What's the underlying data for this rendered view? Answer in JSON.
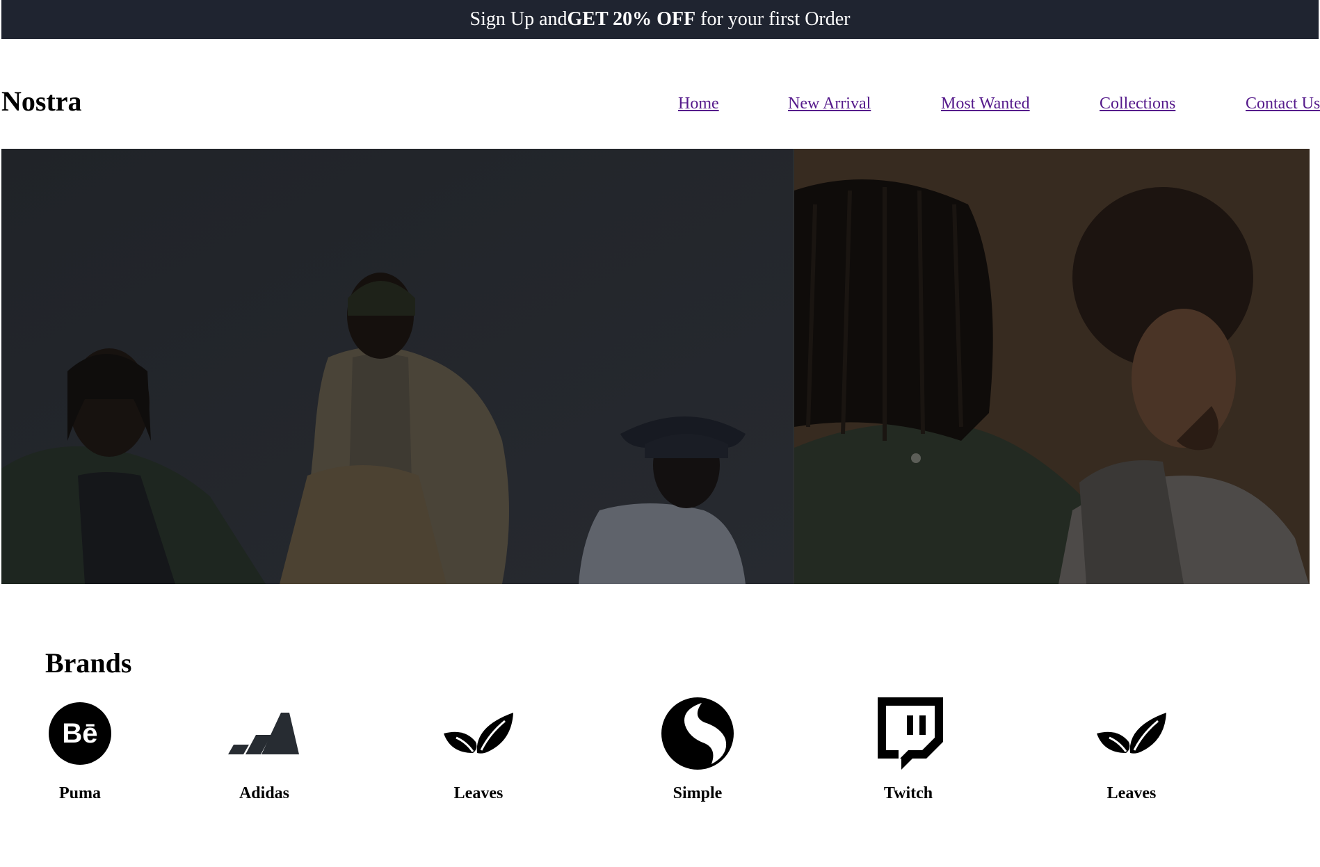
{
  "promo": {
    "prefix": "Sign Up and",
    "highlight": "GET 20% OFF",
    "suffix": " for your first Order"
  },
  "header": {
    "logo": "Nostra",
    "nav": [
      {
        "label": "Home"
      },
      {
        "label": "New Arrival"
      },
      {
        "label": "Most Wanted"
      },
      {
        "label": "Collections"
      },
      {
        "label": "Contact Us"
      }
    ]
  },
  "hero": {
    "left_image": "group-of-three-men-photo",
    "right_image": "two-men-portrait-photo"
  },
  "brands": {
    "title": "Brands",
    "items": [
      {
        "label": "Puma",
        "icon": "behance-icon"
      },
      {
        "label": "Adidas",
        "icon": "adidas-icon"
      },
      {
        "label": "Leaves",
        "icon": "leaves-icon"
      },
      {
        "label": "Simple",
        "icon": "simple-icon"
      },
      {
        "label": "Twitch",
        "icon": "twitch-icon"
      },
      {
        "label": "Leaves",
        "icon": "leaves-icon"
      }
    ]
  },
  "colors": {
    "banner_bg": "#1f2430",
    "link": "#551a8b",
    "text": "#000000"
  }
}
